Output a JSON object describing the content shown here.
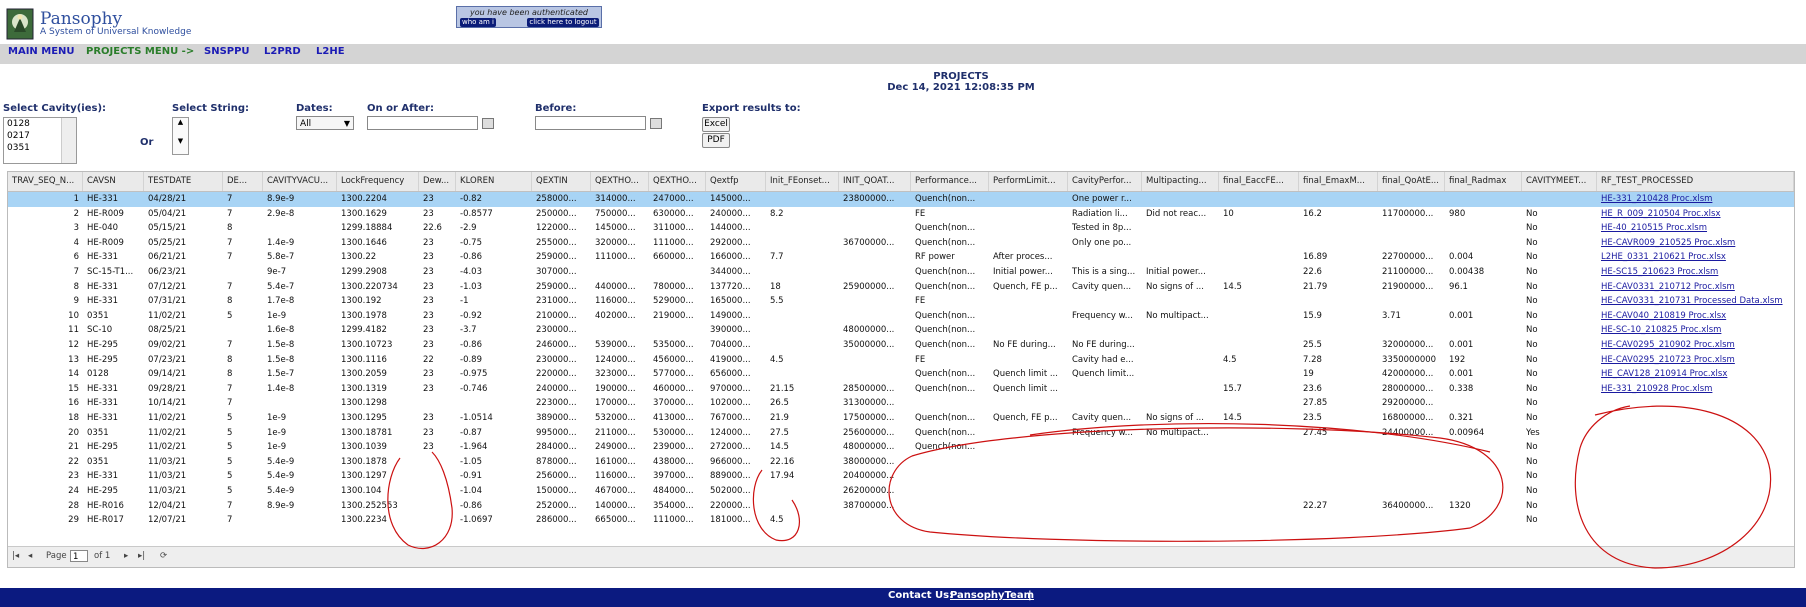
{
  "header": {
    "brand_title": "Pansophy",
    "brand_subtitle": "A System of Universal Knowledge",
    "auth_text": "you have been authenticated",
    "who_button": "who am i",
    "logout_button": "click here to logout"
  },
  "menu": {
    "main": "MAIN MENU",
    "projects": "PROJECTS MENU ->",
    "snsppu": "SNSPPU",
    "l2prd": "L2PRD",
    "l2he": "L2HE"
  },
  "page": {
    "title": "PROJECTS",
    "datetime": "Dec 14, 2021 12:08:35 PM"
  },
  "filters": {
    "cavity_label": "Select Cavity(ies):",
    "cavity_options": [
      "0128",
      "0217",
      "0351"
    ],
    "or_label": "Or",
    "string_label": "Select String:",
    "dates_label": "Dates:",
    "dates_value": "All",
    "on_after_label": "On or After:",
    "before_label": "Before:",
    "export_label": "Export results to:",
    "excel_button": "Excel",
    "pdf_button": "PDF"
  },
  "grid": {
    "columns": [
      "TRAV_SEQ_N...",
      "CAVSN",
      "TESTDATE",
      "DE...",
      "CAVITYVACU...",
      "LockFrequency",
      "Dew...",
      "KLOREN",
      "QEXTIN",
      "QEXTHO...",
      "QEXTHO...",
      "Qextfp",
      "Init_FEonset...",
      "INIT_QOAT...",
      "Performance...",
      "PerformLimit...",
      "CavityPerfor...",
      "Multipacting...",
      "final_EaccFE...",
      "final_EmaxM...",
      "final_QoAtE...",
      "final_Radmax",
      "CAVITYMEET...",
      "RF_TEST_PROCESSED"
    ],
    "rows": [
      [
        "1",
        "HE-331",
        "04/28/21",
        "7",
        "8.9e-9",
        "1300.2204",
        "23",
        "-0.82",
        "258000...",
        "314000...",
        "247000...",
        "145000...",
        "",
        "23800000...",
        "Quench(non...",
        "",
        "One power r...",
        "",
        "",
        "",
        "",
        "",
        "",
        "HE-331_210428 Proc.xlsm"
      ],
      [
        "2",
        "HE-R009",
        "05/04/21",
        "7",
        "2.9e-8",
        "1300.1629",
        "23",
        "-0.8577",
        "250000...",
        "750000...",
        "630000...",
        "240000...",
        "8.2",
        "",
        "FE",
        "",
        "Radiation li...",
        "Did not reac...",
        "10",
        "16.2",
        "11700000...",
        "980",
        "No",
        "HE_R_009_210504 Proc.xlsx"
      ],
      [
        "3",
        "HE-040",
        "05/15/21",
        "8",
        "",
        "1299.18884",
        "22.6",
        "-2.9",
        "122000...",
        "145000...",
        "311000...",
        "144000...",
        "",
        "",
        "Quench(non...",
        "",
        "Tested in 8p...",
        "",
        "",
        "",
        "",
        "",
        "No",
        "HE-40_210515 Proc.xlsm"
      ],
      [
        "4",
        "HE-R009",
        "05/25/21",
        "7",
        "1.4e-9",
        "1300.1646",
        "23",
        "-0.75",
        "255000...",
        "320000...",
        "111000...",
        "292000...",
        "",
        "36700000...",
        "Quench(non...",
        "",
        "Only one po...",
        "",
        "",
        "",
        "",
        "",
        "No",
        "HE-CAVR009_210525 Proc.xlsm"
      ],
      [
        "6",
        "HE-331",
        "06/21/21",
        "7",
        "5.8e-7",
        "1300.22",
        "23",
        "-0.86",
        "259000...",
        "111000...",
        "660000...",
        "166000...",
        "7.7",
        "",
        "RF power",
        "After proces...",
        "",
        "",
        "",
        "16.89",
        "22700000...",
        "0.004",
        "No",
        "L2HE_0331_210621 Proc.xlsx"
      ],
      [
        "7",
        "SC-15-T1...",
        "06/23/21",
        "",
        "9e-7",
        "1299.2908",
        "23",
        "-4.03",
        "307000...",
        "",
        "",
        "344000...",
        "",
        "",
        "Quench(non...",
        "Initial power...",
        "This is a sing...",
        "Initial power...",
        "",
        "22.6",
        "21100000...",
        "0.00438",
        "No",
        "HE-SC15_210623 Proc.xlsm"
      ],
      [
        "8",
        "HE-331",
        "07/12/21",
        "7",
        "5.4e-7",
        "1300.220734",
        "23",
        "-1.03",
        "259000...",
        "440000...",
        "780000...",
        "137720...",
        "18",
        "25900000...",
        "Quench(non...",
        "Quench, FE p...",
        "Cavity quen...",
        "No signs of ...",
        "14.5",
        "21.79",
        "21900000...",
        "96.1",
        "No",
        "HE-CAV0331_210712 Proc.xlsm"
      ],
      [
        "9",
        "HE-331",
        "07/31/21",
        "8",
        "1.7e-8",
        "1300.192",
        "23",
        "-1",
        "231000...",
        "116000...",
        "529000...",
        "165000...",
        "5.5",
        "",
        "FE",
        "",
        "",
        "",
        "",
        "",
        "",
        "",
        "No",
        "HE-CAV0331_210731 Processed Data.xlsm"
      ],
      [
        "10",
        "0351",
        "11/02/21",
        "5",
        "1e-9",
        "1300.1978",
        "23",
        "-0.92",
        "210000...",
        "402000...",
        "219000...",
        "149000...",
        "",
        "",
        "Quench(non...",
        "",
        "Frequency w...",
        "No multipact...",
        "",
        "15.9",
        "3.71",
        "0.001",
        "No",
        "HE-CAV040_210819 Proc.xlsx"
      ],
      [
        "11",
        "SC-10",
        "08/25/21",
        "",
        "1.6e-8",
        "1299.4182",
        "23",
        "-3.7",
        "230000...",
        "",
        "",
        "390000...",
        "",
        "48000000...",
        "Quench(non...",
        "",
        "",
        "",
        "",
        "",
        "",
        "",
        "No",
        "HE-SC-10_210825 Proc.xlsm"
      ],
      [
        "12",
        "HE-295",
        "09/02/21",
        "7",
        "1.5e-8",
        "1300.10723",
        "23",
        "-0.86",
        "246000...",
        "539000...",
        "535000...",
        "704000...",
        "",
        "35000000...",
        "Quench(non...",
        "No FE during...",
        "No FE during...",
        "",
        "",
        "25.5",
        "32000000...",
        "0.001",
        "No",
        "HE-CAV0295_210902 Proc.xlsm"
      ],
      [
        "13",
        "HE-295",
        "07/23/21",
        "8",
        "1.5e-8",
        "1300.1116",
        "22",
        "-0.89",
        "230000...",
        "124000...",
        "456000...",
        "419000...",
        "4.5",
        "",
        "FE",
        "",
        "Cavity had e...",
        "",
        "4.5",
        "7.28",
        "3350000000",
        "192",
        "No",
        "HE-CAV0295_210723 Proc.xlsm"
      ],
      [
        "14",
        "0128",
        "09/14/21",
        "8",
        "1.5e-7",
        "1300.2059",
        "23",
        "-0.975",
        "220000...",
        "323000...",
        "577000...",
        "656000...",
        "",
        "",
        "Quench(non...",
        "Quench limit ...",
        "Quench limit...",
        "",
        "",
        "19",
        "42000000...",
        "0.001",
        "No",
        "HE_CAV128_210914 Proc.xlsx"
      ],
      [
        "15",
        "HE-331",
        "09/28/21",
        "7",
        "1.4e-8",
        "1300.1319",
        "23",
        "-0.746",
        "240000...",
        "190000...",
        "460000...",
        "970000...",
        "21.15",
        "28500000...",
        "Quench(non...",
        "Quench limit ...",
        "",
        "",
        "15.7",
        "23.6",
        "28000000...",
        "0.338",
        "No",
        "HE-331_210928 Proc.xlsm"
      ],
      [
        "16",
        "HE-331",
        "10/14/21",
        "7",
        "",
        "1300.1298",
        "",
        "",
        "223000...",
        "170000...",
        "370000...",
        "102000...",
        "26.5",
        "31300000...",
        "",
        "",
        "",
        "",
        "",
        "27.85",
        "29200000...",
        "",
        "No",
        ""
      ],
      [
        "18",
        "HE-331",
        "11/02/21",
        "5",
        "1e-9",
        "1300.1295",
        "23",
        "-1.0514",
        "389000...",
        "532000...",
        "413000...",
        "767000...",
        "21.9",
        "17500000...",
        "Quench(non...",
        "Quench, FE p...",
        "Cavity quen...",
        "No signs of ...",
        "14.5",
        "23.5",
        "16800000...",
        "0.321",
        "No",
        ""
      ],
      [
        "20",
        "0351",
        "11/02/21",
        "5",
        "1e-9",
        "1300.18781",
        "23",
        "-0.87",
        "995000...",
        "211000...",
        "530000...",
        "124000...",
        "27.5",
        "25600000...",
        "Quench(non...",
        "",
        "Frequency w...",
        "No multipact...",
        "",
        "27.45",
        "24400000...",
        "0.00964",
        "Yes",
        ""
      ],
      [
        "21",
        "HE-295",
        "11/02/21",
        "5",
        "1e-9",
        "1300.1039",
        "23",
        "-1.964",
        "284000...",
        "249000...",
        "239000...",
        "272000...",
        "14.5",
        "48000000...",
        "Quench(non...",
        "",
        "",
        "",
        "",
        "",
        "",
        "",
        "No",
        ""
      ],
      [
        "22",
        "0351",
        "11/03/21",
        "5",
        "5.4e-9",
        "1300.1878",
        "",
        "-1.05",
        "878000...",
        "161000...",
        "438000...",
        "966000...",
        "22.16",
        "38000000...",
        "",
        "",
        "",
        "",
        "",
        "",
        "",
        "",
        "No",
        ""
      ],
      [
        "23",
        "HE-331",
        "11/03/21",
        "5",
        "5.4e-9",
        "1300.1297",
        "",
        "-0.91",
        "256000...",
        "116000...",
        "397000...",
        "889000...",
        "17.94",
        "20400000...",
        "",
        "",
        "",
        "",
        "",
        "",
        "",
        "",
        "No",
        ""
      ],
      [
        "24",
        "HE-295",
        "11/03/21",
        "5",
        "5.4e-9",
        "1300.104",
        "",
        "-1.04",
        "150000...",
        "467000...",
        "484000...",
        "502000...",
        "",
        "26200000...",
        "",
        "",
        "",
        "",
        "",
        "",
        "",
        "",
        "No",
        ""
      ],
      [
        "28",
        "HE-R016",
        "12/04/21",
        "7",
        "8.9e-9",
        "1300.252553",
        "",
        "-0.86",
        "252000...",
        "140000...",
        "354000...",
        "220000...",
        "",
        "38700000...",
        "",
        "",
        "",
        "",
        "",
        "22.27",
        "36400000...",
        "1320",
        "No",
        ""
      ],
      [
        "29",
        "HE-R017",
        "12/07/21",
        "7",
        "",
        "1300.2234",
        "",
        "-1.0697",
        "286000...",
        "665000...",
        "111000...",
        "181000...",
        "4.5",
        "",
        "",
        "",
        "",
        "",
        "",
        "",
        "",
        "",
        "No",
        ""
      ]
    ],
    "footer": {
      "page_label": "Page",
      "page_value": "1",
      "of_label": "of 1"
    }
  },
  "contact": {
    "label": "Contact Us:",
    "link": "PansophyTeam",
    "sep": "|"
  },
  "colors": {
    "selected_row": "#a8d4f5",
    "footer": "#0b1a80",
    "menu_bar": "#d4d4d4",
    "annotation": "#cc1111"
  }
}
